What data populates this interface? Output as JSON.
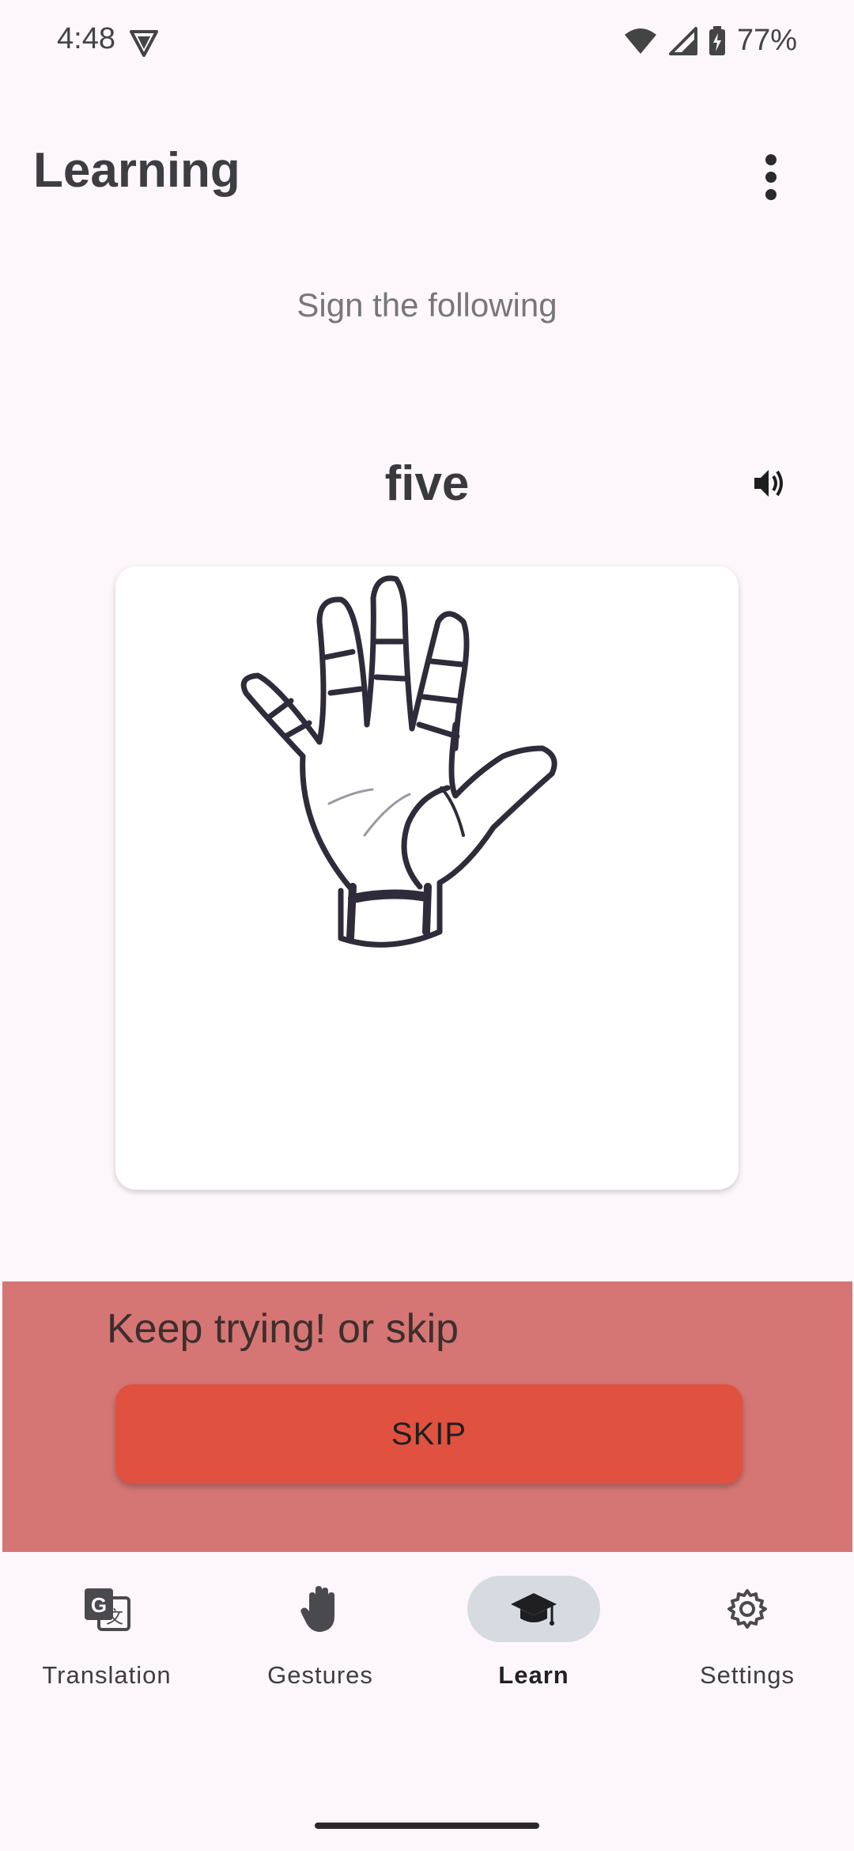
{
  "status": {
    "time": "4:48",
    "battery": "77%",
    "icons": [
      "vpn-icon",
      "wifi-icon",
      "signal-icon",
      "battery-charging-icon"
    ]
  },
  "appbar": {
    "title": "Learning",
    "more_icon": "more-vert-icon"
  },
  "lesson": {
    "prompt": "Sign the following",
    "word": "five",
    "speaker_icon": "volume-up-icon",
    "image_icon": "open-hand-five-illustration"
  },
  "feedback": {
    "message": "Keep trying! or skip",
    "skip_label": "SKIP",
    "background": "#D57674",
    "button_color": "#E05140"
  },
  "nav": {
    "items": [
      {
        "label": "Translation",
        "icon": "translate-icon",
        "active": false
      },
      {
        "label": "Gestures",
        "icon": "hand-icon",
        "active": false
      },
      {
        "label": "Learn",
        "icon": "graduation-cap-icon",
        "active": true
      },
      {
        "label": "Settings",
        "icon": "gear-icon",
        "active": false
      }
    ]
  },
  "colors": {
    "background": "#FDF7FB",
    "nav_active_pill": "#D6DBE1"
  }
}
